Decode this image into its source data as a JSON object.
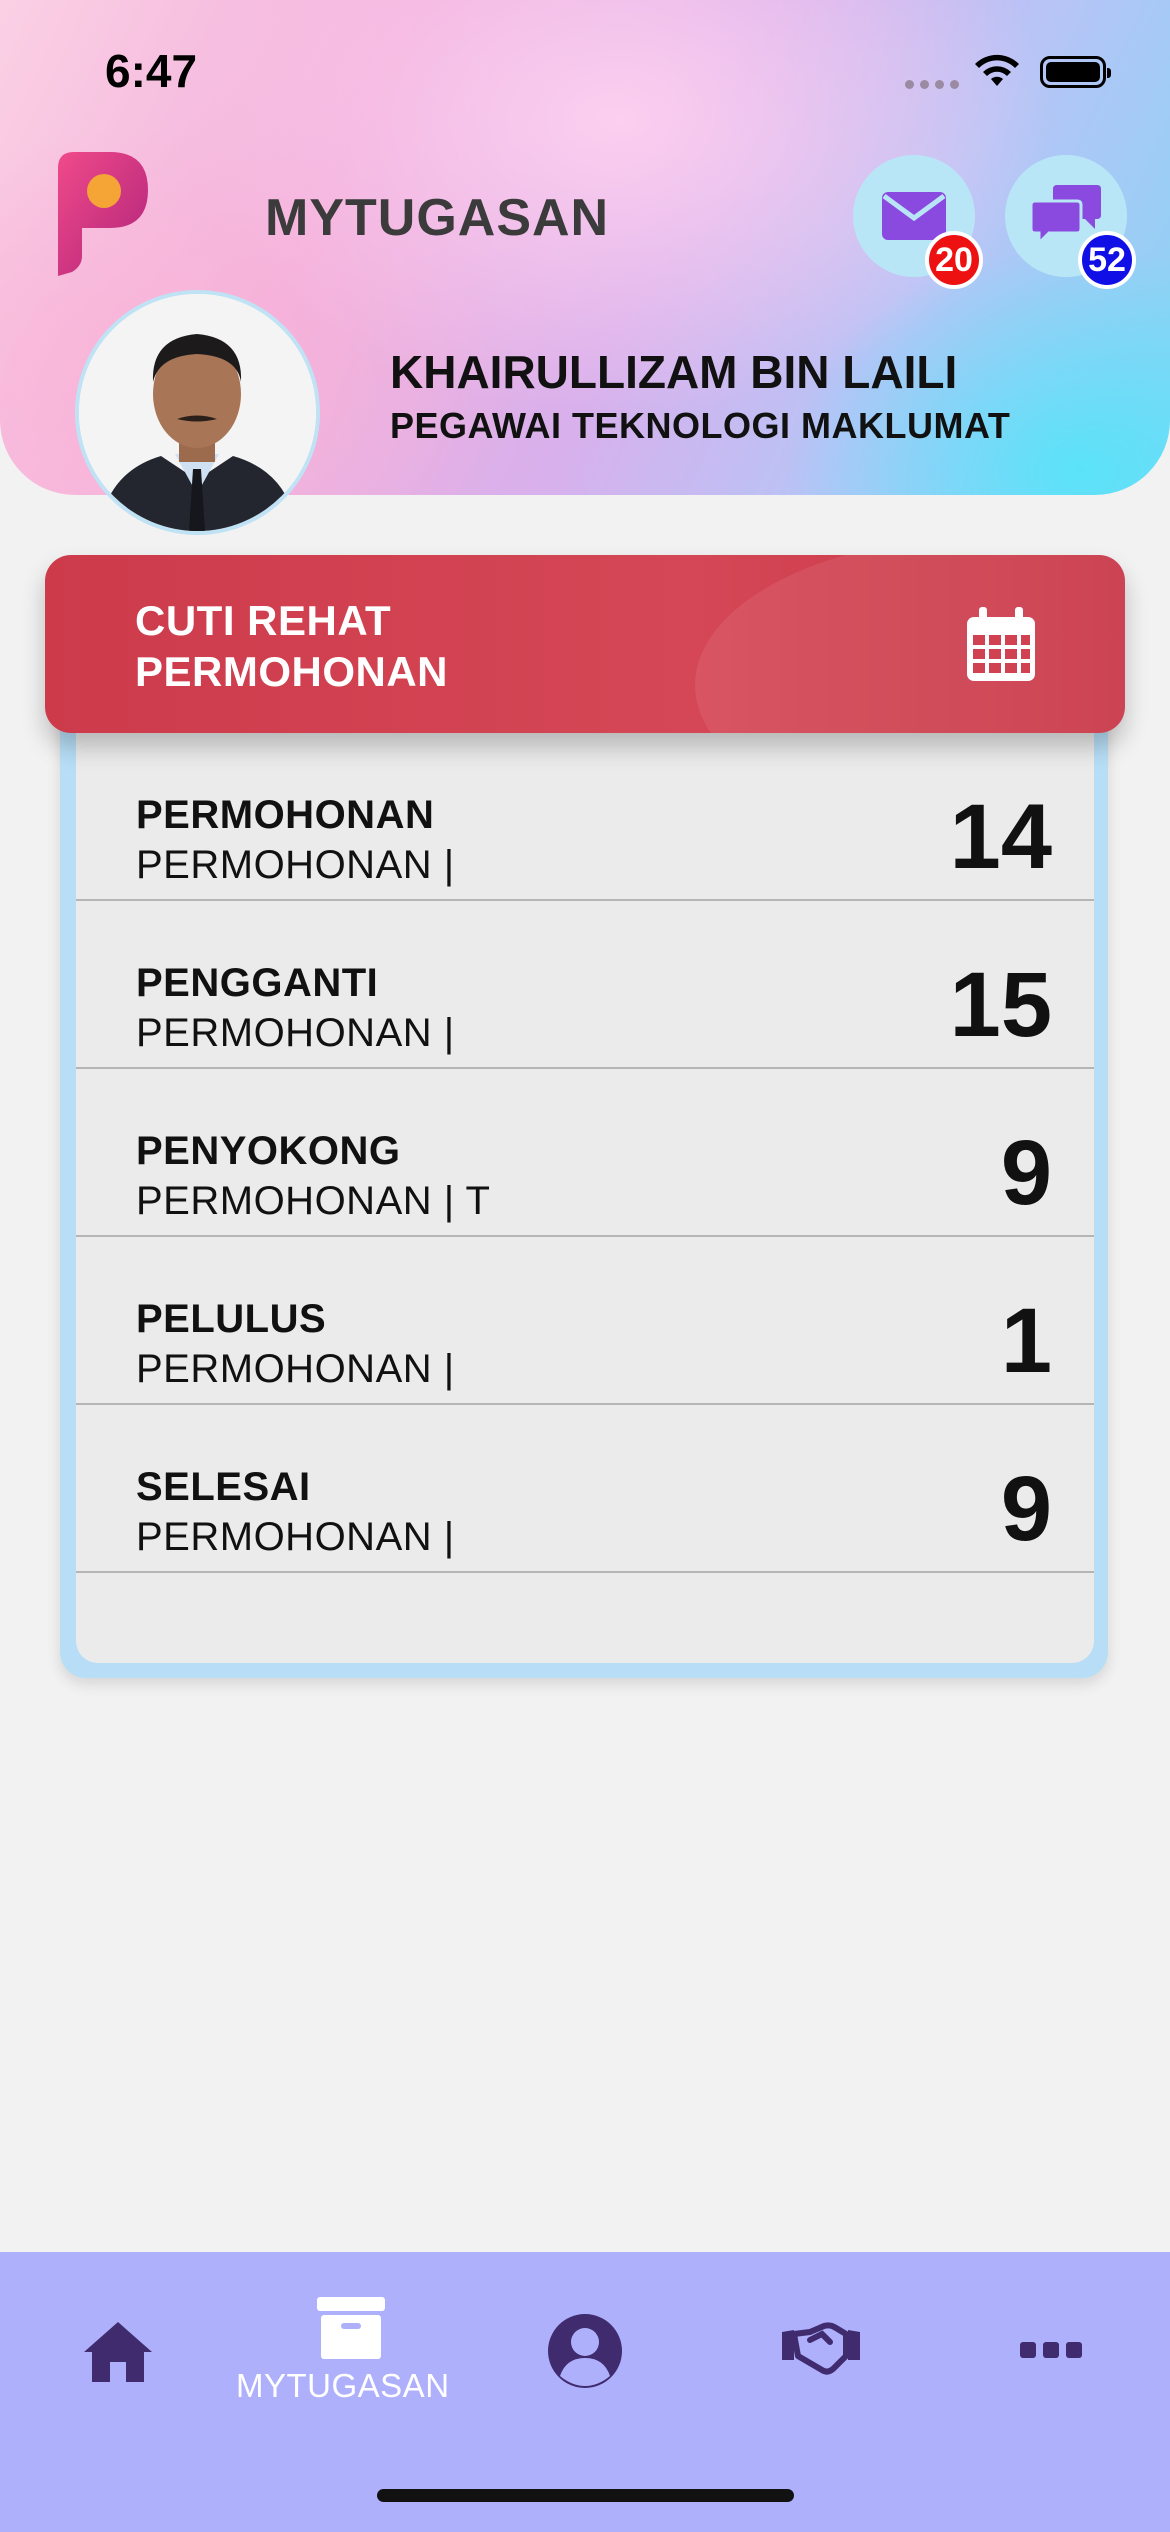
{
  "status_bar": {
    "time": "6:47"
  },
  "header": {
    "app_title": "MYTUGASAN",
    "mail_badge": "20",
    "chat_badge": "52",
    "user_name": "KHAIRULLIZAM BIN LAILI",
    "user_role": "PEGAWAI TEKNOLOGI MAKLUMAT"
  },
  "card": {
    "title_line1": "CUTI REHAT",
    "title_line2": "PERMOHONAN",
    "icon": "calendar-icon",
    "rows": [
      {
        "title": "PERMOHONAN",
        "subtitle": "PERMOHONAN |",
        "count": "14"
      },
      {
        "title": "PENGGANTI",
        "subtitle": "PERMOHONAN |",
        "count": "15"
      },
      {
        "title": "PENYOKONG",
        "subtitle": "PERMOHONAN | T",
        "count": "9"
      },
      {
        "title": "PELULUS",
        "subtitle": "PERMOHONAN |",
        "count": "1"
      },
      {
        "title": "SELESAI",
        "subtitle": "PERMOHONAN |",
        "count": "9"
      }
    ]
  },
  "tabbar": {
    "active_label": "MYTUGASAN",
    "icons": [
      "home-icon",
      "archive-box-icon",
      "user-circle-icon",
      "handshake-icon",
      "more-icon"
    ]
  },
  "colors": {
    "card_header": "#cd3b4b",
    "tabbar": "#aeb0fb",
    "tab_icon": "#3f2b6e",
    "badge_red": "#ee1111",
    "badge_blue": "#1010e6"
  }
}
